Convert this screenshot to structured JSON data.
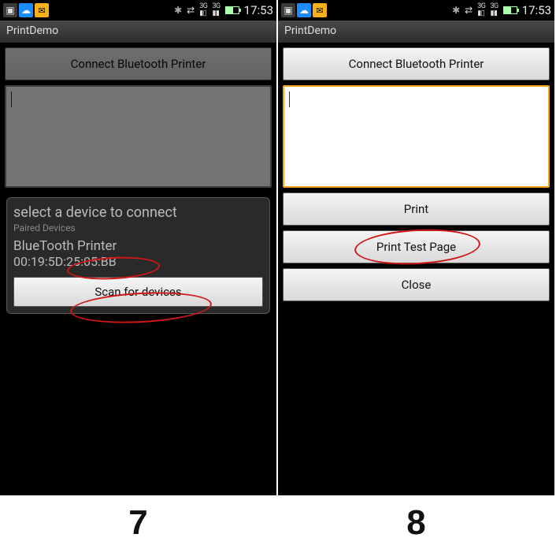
{
  "status": {
    "time": "17:53",
    "signal1": "3G",
    "signal2": "3G"
  },
  "app": {
    "title": "PrintDemo"
  },
  "buttons": {
    "connect": "Connect Bluetooth Printer",
    "print": "Print",
    "print_test": "Print Test Page",
    "close": "Close",
    "scan": "Scan for devices"
  },
  "dialog": {
    "title": "select a device to connect",
    "subtitle": "Paired Devices",
    "device_name": "BlueTooth Printer",
    "device_addr": "00:19:5D:25:05:BB"
  },
  "figures": {
    "left": "7",
    "right": "8"
  }
}
